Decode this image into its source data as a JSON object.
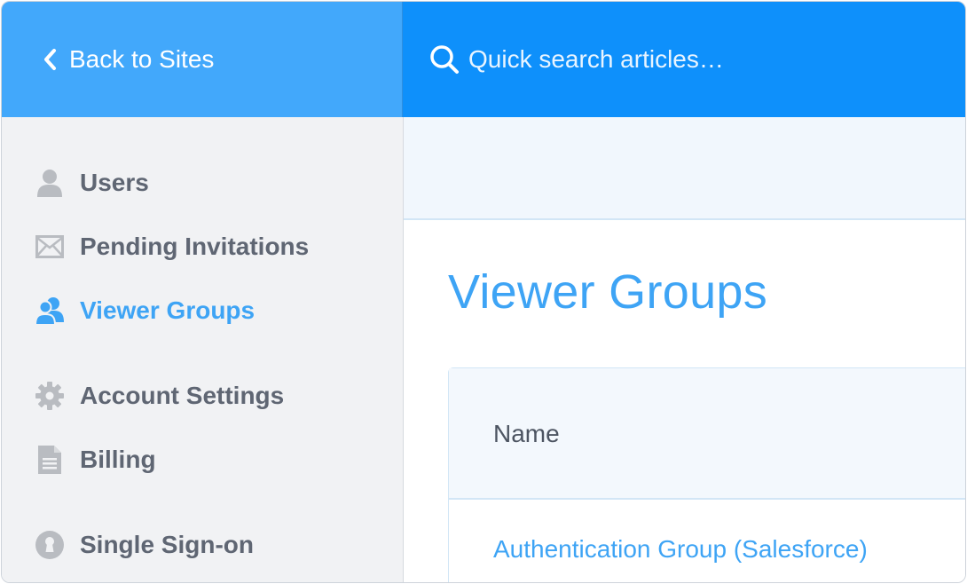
{
  "topbar": {
    "back_label": "Back to Sites",
    "search_placeholder": "Quick search articles…"
  },
  "sidebar": {
    "items": [
      {
        "label": "Users",
        "icon": "user-icon",
        "active": false
      },
      {
        "label": "Pending Invitations",
        "icon": "envelope-icon",
        "active": false
      },
      {
        "label": "Viewer Groups",
        "icon": "users-group-icon",
        "active": true
      },
      {
        "label": "Account Settings",
        "icon": "gear-icon",
        "active": false
      },
      {
        "label": "Billing",
        "icon": "document-icon",
        "active": false
      },
      {
        "label": "Single Sign-on",
        "icon": "keyhole-icon",
        "active": false
      }
    ]
  },
  "main": {
    "title": "Viewer Groups",
    "table": {
      "columns": [
        "Name"
      ],
      "rows": [
        {
          "name": "Authentication Group (Salesforce)"
        }
      ]
    }
  },
  "colors": {
    "back_bar": "#42a8fb",
    "search_bar": "#0e90fb",
    "accent": "#3ea4f5",
    "sidebar_bg": "#f1f2f4",
    "nav_text": "#5f6673"
  }
}
